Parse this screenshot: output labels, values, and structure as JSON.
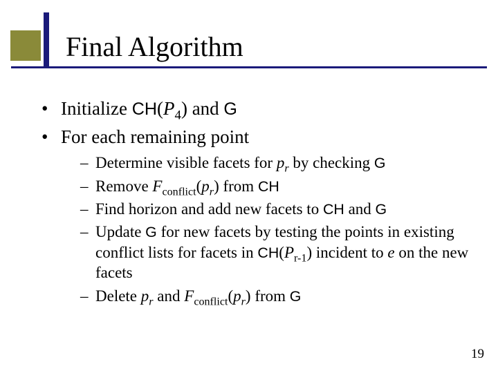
{
  "title": "Final Algorithm",
  "page_number": "19",
  "bullets": [
    {
      "parts": [
        "Initialize ",
        "CH",
        "P",
        "4",
        " and ",
        "G"
      ]
    },
    {
      "text": "For each remaining point"
    }
  ],
  "sub": [
    {
      "parts": [
        "Determine visible facets for ",
        "p",
        "r",
        " by checking ",
        "G"
      ]
    },
    {
      "parts": [
        "Remove ",
        "F",
        "conflict",
        "p",
        "r",
        " from ",
        "CH"
      ]
    },
    {
      "parts": [
        "Find horizon and add new facets to ",
        "CH",
        " and ",
        "G"
      ]
    },
    {
      "parts": [
        "Update ",
        "G",
        " for new facets by testing the points in existing conflict lists for facets in ",
        "CH",
        "P",
        "r-1",
        " incident to ",
        "e",
        " on the new facets"
      ]
    },
    {
      "parts": [
        "Delete ",
        "p",
        "r",
        " and ",
        "F",
        "conflict",
        "p",
        "r",
        " from ",
        "G"
      ]
    }
  ]
}
